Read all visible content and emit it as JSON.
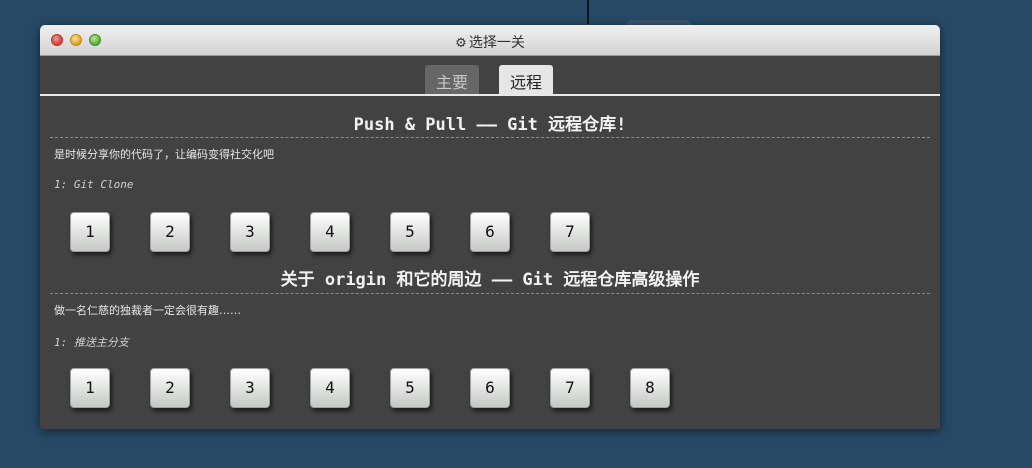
{
  "window": {
    "title": "选择一关",
    "title_icon": "gear-icon"
  },
  "tabs": [
    {
      "label": "主要",
      "active": false
    },
    {
      "label": "远程",
      "active": true
    }
  ],
  "sections": [
    {
      "title": "Push & Pull —— Git 远程仓库!",
      "description": "是时候分享你的代码了，让编码变得社交化吧",
      "subtitle": "1: Git Clone",
      "levels": [
        "1",
        "2",
        "3",
        "4",
        "5",
        "6",
        "7"
      ]
    },
    {
      "title": "关于 origin 和它的周边 —— Git 远程仓库高级操作",
      "description": "做一名仁慈的独裁者一定会很有趣……",
      "subtitle": "1: 推送主分支",
      "levels": [
        "1",
        "2",
        "3",
        "4",
        "5",
        "6",
        "7",
        "8"
      ]
    }
  ]
}
